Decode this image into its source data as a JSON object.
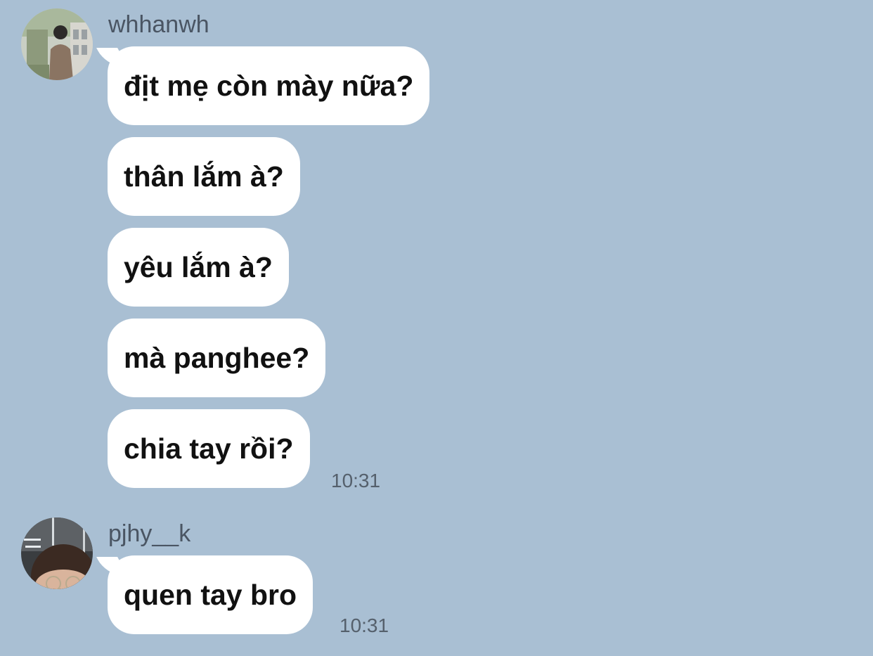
{
  "chat": {
    "groups": [
      {
        "sender": "whhanwh",
        "messages": [
          "địt mẹ còn mày nữa?",
          "thân lắm à?",
          "yêu lắm à?",
          "mà panghee?",
          "chia tay rồi?"
        ],
        "time": "10:31"
      },
      {
        "sender": "pjhy__k",
        "messages": [
          "quen tay bro"
        ],
        "time": "10:31"
      }
    ]
  },
  "colors": {
    "background": "#a9bfd3",
    "bubble": "#ffffff",
    "sender_text": "#4a5563",
    "message_text": "#111111",
    "time_text": "#55606c"
  },
  "icons": {
    "avatar_1": "profile-photo-person-outdoors",
    "avatar_2": "profile-photo-face-with-glasses"
  }
}
